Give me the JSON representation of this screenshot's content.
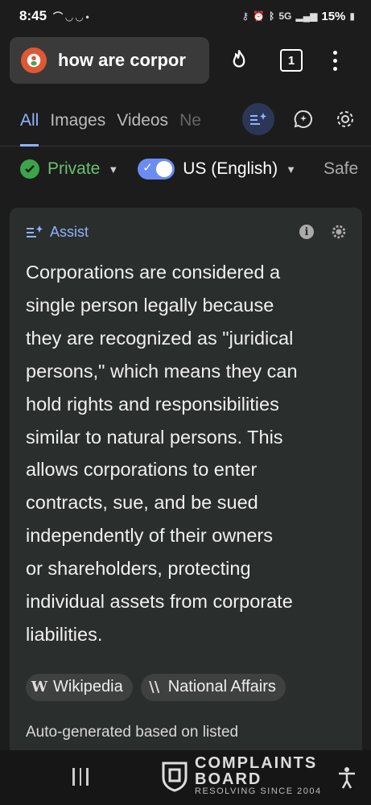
{
  "status_bar": {
    "time": "8:45",
    "battery": "15%",
    "network": "5G"
  },
  "search": {
    "query": "how are corpor"
  },
  "header": {
    "tab_count": "1"
  },
  "tabs": [
    {
      "label": "All",
      "active": true
    },
    {
      "label": "Images"
    },
    {
      "label": "Videos"
    },
    {
      "label": "Ne"
    }
  ],
  "filters": {
    "private_label": "Private",
    "region_label": "US (English)",
    "safe_label": "Safe"
  },
  "assist": {
    "label": "Assist",
    "lines": [
      "Corporations are considered a",
      "single person legally because",
      "they are recognized as \"juridical",
      "persons,\" which means they can",
      "hold rights and responsibilities",
      "similar to natural persons. This",
      "allows corporations to enter",
      "contracts, sue, and be sued",
      "independently of their owners",
      "or shareholders, protecting",
      "individual assets from corporate",
      "liabilities."
    ],
    "sources": [
      {
        "label": "Wikipedia",
        "icon": "W"
      },
      {
        "label": "National Affairs",
        "icon": "\\\\"
      }
    ],
    "footnote": "Auto-generated based on listed"
  },
  "watermark": {
    "line1": "COMPLAINTS",
    "line2": "BOARD",
    "tagline": "RESOLVING SINCE 2004"
  },
  "colors": {
    "accent": "#8fb3ff",
    "private_green": "#3ca54a",
    "toggle": "#6b8cf3",
    "ddg_orange": "#de5833"
  }
}
